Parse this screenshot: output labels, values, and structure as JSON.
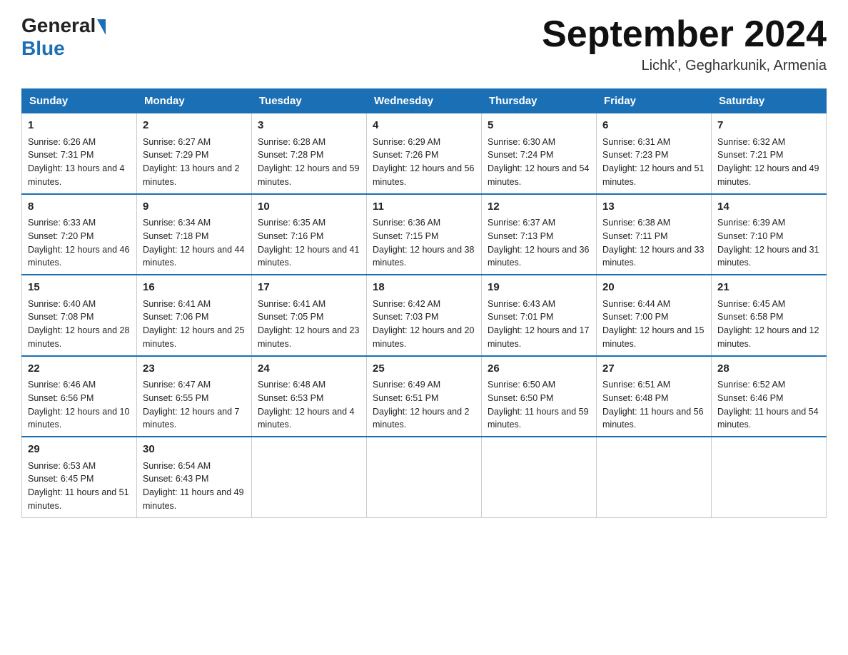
{
  "header": {
    "logo_general": "General",
    "logo_blue": "Blue",
    "month_title": "September 2024",
    "location": "Lichk', Gegharkunik, Armenia"
  },
  "weekdays": [
    "Sunday",
    "Monday",
    "Tuesday",
    "Wednesday",
    "Thursday",
    "Friday",
    "Saturday"
  ],
  "weeks": [
    [
      {
        "day": "1",
        "sunrise": "6:26 AM",
        "sunset": "7:31 PM",
        "daylight": "13 hours and 4 minutes."
      },
      {
        "day": "2",
        "sunrise": "6:27 AM",
        "sunset": "7:29 PM",
        "daylight": "13 hours and 2 minutes."
      },
      {
        "day": "3",
        "sunrise": "6:28 AM",
        "sunset": "7:28 PM",
        "daylight": "12 hours and 59 minutes."
      },
      {
        "day": "4",
        "sunrise": "6:29 AM",
        "sunset": "7:26 PM",
        "daylight": "12 hours and 56 minutes."
      },
      {
        "day": "5",
        "sunrise": "6:30 AM",
        "sunset": "7:24 PM",
        "daylight": "12 hours and 54 minutes."
      },
      {
        "day": "6",
        "sunrise": "6:31 AM",
        "sunset": "7:23 PM",
        "daylight": "12 hours and 51 minutes."
      },
      {
        "day": "7",
        "sunrise": "6:32 AM",
        "sunset": "7:21 PM",
        "daylight": "12 hours and 49 minutes."
      }
    ],
    [
      {
        "day": "8",
        "sunrise": "6:33 AM",
        "sunset": "7:20 PM",
        "daylight": "12 hours and 46 minutes."
      },
      {
        "day": "9",
        "sunrise": "6:34 AM",
        "sunset": "7:18 PM",
        "daylight": "12 hours and 44 minutes."
      },
      {
        "day": "10",
        "sunrise": "6:35 AM",
        "sunset": "7:16 PM",
        "daylight": "12 hours and 41 minutes."
      },
      {
        "day": "11",
        "sunrise": "6:36 AM",
        "sunset": "7:15 PM",
        "daylight": "12 hours and 38 minutes."
      },
      {
        "day": "12",
        "sunrise": "6:37 AM",
        "sunset": "7:13 PM",
        "daylight": "12 hours and 36 minutes."
      },
      {
        "day": "13",
        "sunrise": "6:38 AM",
        "sunset": "7:11 PM",
        "daylight": "12 hours and 33 minutes."
      },
      {
        "day": "14",
        "sunrise": "6:39 AM",
        "sunset": "7:10 PM",
        "daylight": "12 hours and 31 minutes."
      }
    ],
    [
      {
        "day": "15",
        "sunrise": "6:40 AM",
        "sunset": "7:08 PM",
        "daylight": "12 hours and 28 minutes."
      },
      {
        "day": "16",
        "sunrise": "6:41 AM",
        "sunset": "7:06 PM",
        "daylight": "12 hours and 25 minutes."
      },
      {
        "day": "17",
        "sunrise": "6:41 AM",
        "sunset": "7:05 PM",
        "daylight": "12 hours and 23 minutes."
      },
      {
        "day": "18",
        "sunrise": "6:42 AM",
        "sunset": "7:03 PM",
        "daylight": "12 hours and 20 minutes."
      },
      {
        "day": "19",
        "sunrise": "6:43 AM",
        "sunset": "7:01 PM",
        "daylight": "12 hours and 17 minutes."
      },
      {
        "day": "20",
        "sunrise": "6:44 AM",
        "sunset": "7:00 PM",
        "daylight": "12 hours and 15 minutes."
      },
      {
        "day": "21",
        "sunrise": "6:45 AM",
        "sunset": "6:58 PM",
        "daylight": "12 hours and 12 minutes."
      }
    ],
    [
      {
        "day": "22",
        "sunrise": "6:46 AM",
        "sunset": "6:56 PM",
        "daylight": "12 hours and 10 minutes."
      },
      {
        "day": "23",
        "sunrise": "6:47 AM",
        "sunset": "6:55 PM",
        "daylight": "12 hours and 7 minutes."
      },
      {
        "day": "24",
        "sunrise": "6:48 AM",
        "sunset": "6:53 PM",
        "daylight": "12 hours and 4 minutes."
      },
      {
        "day": "25",
        "sunrise": "6:49 AM",
        "sunset": "6:51 PM",
        "daylight": "12 hours and 2 minutes."
      },
      {
        "day": "26",
        "sunrise": "6:50 AM",
        "sunset": "6:50 PM",
        "daylight": "11 hours and 59 minutes."
      },
      {
        "day": "27",
        "sunrise": "6:51 AM",
        "sunset": "6:48 PM",
        "daylight": "11 hours and 56 minutes."
      },
      {
        "day": "28",
        "sunrise": "6:52 AM",
        "sunset": "6:46 PM",
        "daylight": "11 hours and 54 minutes."
      }
    ],
    [
      {
        "day": "29",
        "sunrise": "6:53 AM",
        "sunset": "6:45 PM",
        "daylight": "11 hours and 51 minutes."
      },
      {
        "day": "30",
        "sunrise": "6:54 AM",
        "sunset": "6:43 PM",
        "daylight": "11 hours and 49 minutes."
      },
      null,
      null,
      null,
      null,
      null
    ]
  ],
  "labels": {
    "sunrise": "Sunrise:",
    "sunset": "Sunset:",
    "daylight": "Daylight:"
  }
}
